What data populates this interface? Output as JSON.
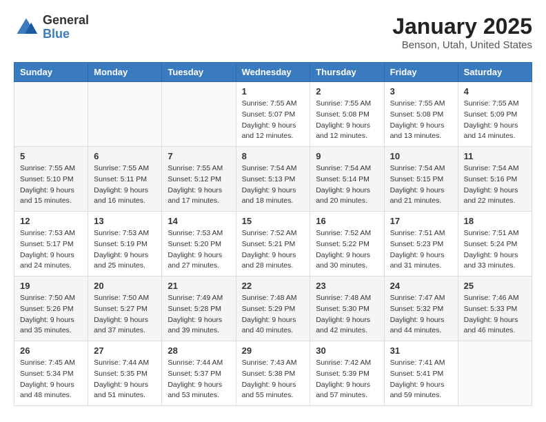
{
  "header": {
    "logo_general": "General",
    "logo_blue": "Blue",
    "title": "January 2025",
    "location": "Benson, Utah, United States"
  },
  "weekdays": [
    "Sunday",
    "Monday",
    "Tuesday",
    "Wednesday",
    "Thursday",
    "Friday",
    "Saturday"
  ],
  "weeks": [
    [
      {
        "day": "",
        "sunrise": "",
        "sunset": "",
        "daylight": ""
      },
      {
        "day": "",
        "sunrise": "",
        "sunset": "",
        "daylight": ""
      },
      {
        "day": "",
        "sunrise": "",
        "sunset": "",
        "daylight": ""
      },
      {
        "day": "1",
        "sunrise": "Sunrise: 7:55 AM",
        "sunset": "Sunset: 5:07 PM",
        "daylight": "Daylight: 9 hours and 12 minutes."
      },
      {
        "day": "2",
        "sunrise": "Sunrise: 7:55 AM",
        "sunset": "Sunset: 5:08 PM",
        "daylight": "Daylight: 9 hours and 12 minutes."
      },
      {
        "day": "3",
        "sunrise": "Sunrise: 7:55 AM",
        "sunset": "Sunset: 5:08 PM",
        "daylight": "Daylight: 9 hours and 13 minutes."
      },
      {
        "day": "4",
        "sunrise": "Sunrise: 7:55 AM",
        "sunset": "Sunset: 5:09 PM",
        "daylight": "Daylight: 9 hours and 14 minutes."
      }
    ],
    [
      {
        "day": "5",
        "sunrise": "Sunrise: 7:55 AM",
        "sunset": "Sunset: 5:10 PM",
        "daylight": "Daylight: 9 hours and 15 minutes."
      },
      {
        "day": "6",
        "sunrise": "Sunrise: 7:55 AM",
        "sunset": "Sunset: 5:11 PM",
        "daylight": "Daylight: 9 hours and 16 minutes."
      },
      {
        "day": "7",
        "sunrise": "Sunrise: 7:55 AM",
        "sunset": "Sunset: 5:12 PM",
        "daylight": "Daylight: 9 hours and 17 minutes."
      },
      {
        "day": "8",
        "sunrise": "Sunrise: 7:54 AM",
        "sunset": "Sunset: 5:13 PM",
        "daylight": "Daylight: 9 hours and 18 minutes."
      },
      {
        "day": "9",
        "sunrise": "Sunrise: 7:54 AM",
        "sunset": "Sunset: 5:14 PM",
        "daylight": "Daylight: 9 hours and 20 minutes."
      },
      {
        "day": "10",
        "sunrise": "Sunrise: 7:54 AM",
        "sunset": "Sunset: 5:15 PM",
        "daylight": "Daylight: 9 hours and 21 minutes."
      },
      {
        "day": "11",
        "sunrise": "Sunrise: 7:54 AM",
        "sunset": "Sunset: 5:16 PM",
        "daylight": "Daylight: 9 hours and 22 minutes."
      }
    ],
    [
      {
        "day": "12",
        "sunrise": "Sunrise: 7:53 AM",
        "sunset": "Sunset: 5:17 PM",
        "daylight": "Daylight: 9 hours and 24 minutes."
      },
      {
        "day": "13",
        "sunrise": "Sunrise: 7:53 AM",
        "sunset": "Sunset: 5:19 PM",
        "daylight": "Daylight: 9 hours and 25 minutes."
      },
      {
        "day": "14",
        "sunrise": "Sunrise: 7:53 AM",
        "sunset": "Sunset: 5:20 PM",
        "daylight": "Daylight: 9 hours and 27 minutes."
      },
      {
        "day": "15",
        "sunrise": "Sunrise: 7:52 AM",
        "sunset": "Sunset: 5:21 PM",
        "daylight": "Daylight: 9 hours and 28 minutes."
      },
      {
        "day": "16",
        "sunrise": "Sunrise: 7:52 AM",
        "sunset": "Sunset: 5:22 PM",
        "daylight": "Daylight: 9 hours and 30 minutes."
      },
      {
        "day": "17",
        "sunrise": "Sunrise: 7:51 AM",
        "sunset": "Sunset: 5:23 PM",
        "daylight": "Daylight: 9 hours and 31 minutes."
      },
      {
        "day": "18",
        "sunrise": "Sunrise: 7:51 AM",
        "sunset": "Sunset: 5:24 PM",
        "daylight": "Daylight: 9 hours and 33 minutes."
      }
    ],
    [
      {
        "day": "19",
        "sunrise": "Sunrise: 7:50 AM",
        "sunset": "Sunset: 5:26 PM",
        "daylight": "Daylight: 9 hours and 35 minutes."
      },
      {
        "day": "20",
        "sunrise": "Sunrise: 7:50 AM",
        "sunset": "Sunset: 5:27 PM",
        "daylight": "Daylight: 9 hours and 37 minutes."
      },
      {
        "day": "21",
        "sunrise": "Sunrise: 7:49 AM",
        "sunset": "Sunset: 5:28 PM",
        "daylight": "Daylight: 9 hours and 39 minutes."
      },
      {
        "day": "22",
        "sunrise": "Sunrise: 7:48 AM",
        "sunset": "Sunset: 5:29 PM",
        "daylight": "Daylight: 9 hours and 40 minutes."
      },
      {
        "day": "23",
        "sunrise": "Sunrise: 7:48 AM",
        "sunset": "Sunset: 5:30 PM",
        "daylight": "Daylight: 9 hours and 42 minutes."
      },
      {
        "day": "24",
        "sunrise": "Sunrise: 7:47 AM",
        "sunset": "Sunset: 5:32 PM",
        "daylight": "Daylight: 9 hours and 44 minutes."
      },
      {
        "day": "25",
        "sunrise": "Sunrise: 7:46 AM",
        "sunset": "Sunset: 5:33 PM",
        "daylight": "Daylight: 9 hours and 46 minutes."
      }
    ],
    [
      {
        "day": "26",
        "sunrise": "Sunrise: 7:45 AM",
        "sunset": "Sunset: 5:34 PM",
        "daylight": "Daylight: 9 hours and 48 minutes."
      },
      {
        "day": "27",
        "sunrise": "Sunrise: 7:44 AM",
        "sunset": "Sunset: 5:35 PM",
        "daylight": "Daylight: 9 hours and 51 minutes."
      },
      {
        "day": "28",
        "sunrise": "Sunrise: 7:44 AM",
        "sunset": "Sunset: 5:37 PM",
        "daylight": "Daylight: 9 hours and 53 minutes."
      },
      {
        "day": "29",
        "sunrise": "Sunrise: 7:43 AM",
        "sunset": "Sunset: 5:38 PM",
        "daylight": "Daylight: 9 hours and 55 minutes."
      },
      {
        "day": "30",
        "sunrise": "Sunrise: 7:42 AM",
        "sunset": "Sunset: 5:39 PM",
        "daylight": "Daylight: 9 hours and 57 minutes."
      },
      {
        "day": "31",
        "sunrise": "Sunrise: 7:41 AM",
        "sunset": "Sunset: 5:41 PM",
        "daylight": "Daylight: 9 hours and 59 minutes."
      },
      {
        "day": "",
        "sunrise": "",
        "sunset": "",
        "daylight": ""
      }
    ]
  ]
}
